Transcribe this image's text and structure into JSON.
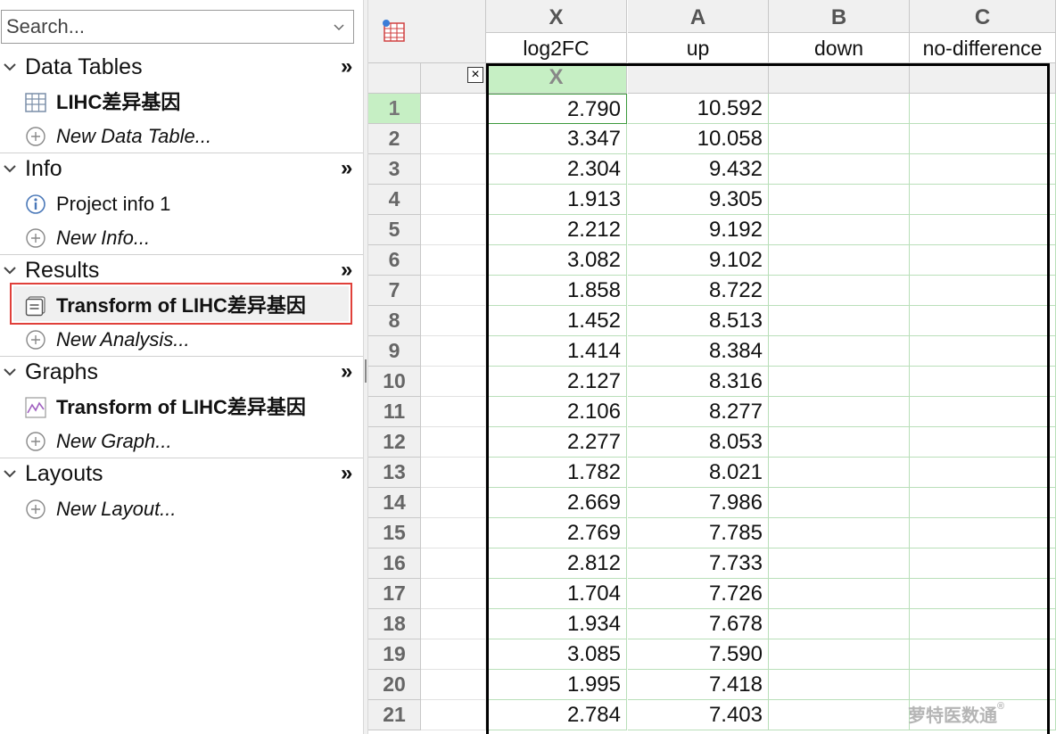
{
  "sidebar": {
    "search_placeholder": "Search...",
    "sections": [
      {
        "title": "Data Tables",
        "more": "»",
        "items": [
          {
            "label": "LIHC差异基因",
            "icon": "data-table-icon"
          },
          {
            "label": "New Data Table...",
            "icon": "add-circle-icon"
          }
        ]
      },
      {
        "title": "Info",
        "more": "»",
        "items": [
          {
            "label": "Project info 1",
            "icon": "info-icon"
          },
          {
            "label": "New Info...",
            "icon": "add-circle-icon"
          }
        ]
      },
      {
        "title": "Results",
        "more": "»",
        "items": [
          {
            "label": "Transform of LIHC差异基因",
            "icon": "results-sheet-icon"
          },
          {
            "label": "New Analysis...",
            "icon": "add-circle-icon"
          }
        ]
      },
      {
        "title": "Graphs",
        "more": "»",
        "items": [
          {
            "label": "Transform of LIHC差异基因",
            "icon": "graph-icon"
          },
          {
            "label": "New Graph...",
            "icon": "add-circle-icon"
          }
        ]
      },
      {
        "title": "Layouts",
        "more": "»",
        "items": [
          {
            "label": "New Layout...",
            "icon": "add-circle-icon"
          }
        ]
      }
    ]
  },
  "table": {
    "columns": [
      {
        "letter": "X",
        "title": "log2FC",
        "sub": "X"
      },
      {
        "letter": "A",
        "title": "up",
        "sub": ""
      },
      {
        "letter": "B",
        "title": "down",
        "sub": ""
      },
      {
        "letter": "C",
        "title": "no-difference",
        "sub": ""
      }
    ],
    "rows": [
      {
        "n": "1",
        "x": "2.790",
        "a": "10.592"
      },
      {
        "n": "2",
        "x": "3.347",
        "a": "10.058"
      },
      {
        "n": "3",
        "x": "2.304",
        "a": "9.432"
      },
      {
        "n": "4",
        "x": "1.913",
        "a": "9.305"
      },
      {
        "n": "5",
        "x": "2.212",
        "a": "9.192"
      },
      {
        "n": "6",
        "x": "3.082",
        "a": "9.102"
      },
      {
        "n": "7",
        "x": "1.858",
        "a": "8.722"
      },
      {
        "n": "8",
        "x": "1.452",
        "a": "8.513"
      },
      {
        "n": "9",
        "x": "1.414",
        "a": "8.384"
      },
      {
        "n": "10",
        "x": "2.127",
        "a": "8.316"
      },
      {
        "n": "11",
        "x": "2.106",
        "a": "8.277"
      },
      {
        "n": "12",
        "x": "2.277",
        "a": "8.053"
      },
      {
        "n": "13",
        "x": "1.782",
        "a": "8.021"
      },
      {
        "n": "14",
        "x": "2.669",
        "a": "7.986"
      },
      {
        "n": "15",
        "x": "2.769",
        "a": "7.785"
      },
      {
        "n": "16",
        "x": "2.812",
        "a": "7.733"
      },
      {
        "n": "17",
        "x": "1.704",
        "a": "7.726"
      },
      {
        "n": "18",
        "x": "1.934",
        "a": "7.678"
      },
      {
        "n": "19",
        "x": "3.085",
        "a": "7.590"
      },
      {
        "n": "20",
        "x": "1.995",
        "a": "7.418"
      },
      {
        "n": "21",
        "x": "2.784",
        "a": "7.403"
      }
    ],
    "close_label": "×"
  },
  "watermark": {
    "text": "萝特医数通",
    "reg": "®"
  },
  "colors": {
    "accent_green": "#c6efc4",
    "selection_red": "#e0403a"
  }
}
